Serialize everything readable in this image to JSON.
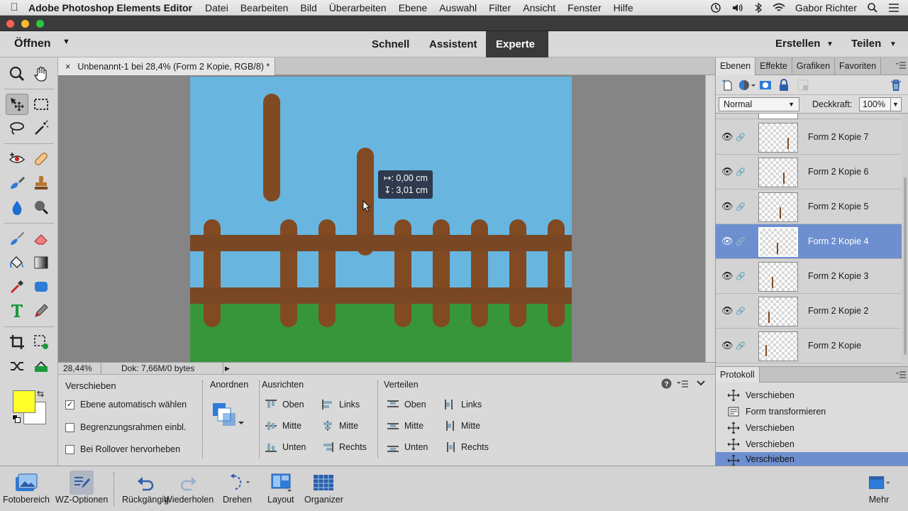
{
  "menubar": {
    "app_name": "Adobe Photoshop Elements Editor",
    "items": [
      "Datei",
      "Bearbeiten",
      "Bild",
      "Überarbeiten",
      "Ebene",
      "Auswahl",
      "Filter",
      "Ansicht",
      "Fenster",
      "Hilfe"
    ],
    "user": "Gabor Richter"
  },
  "modebar": {
    "open_label": "Öffnen",
    "modes": [
      "Schnell",
      "Assistent",
      "Experte"
    ],
    "active_mode": "Experte",
    "create_label": "Erstellen",
    "share_label": "Teilen"
  },
  "document": {
    "tab_title": "Unbenannt-1 bei 28,4% (Form 2 Kopie, RGB/8) *",
    "close_glyph": "×",
    "zoom": "28,44%",
    "doc_info": "Dok: 7,66M/0 bytes",
    "tooltip_line1": "↦: 0,00 cm",
    "tooltip_line2": "↧: 3,01 cm"
  },
  "colors": {
    "sky": "#68b6e0",
    "grass": "#37963a",
    "wood": "#814a22",
    "rail": "#7a4724",
    "foreground": "#ffff2a",
    "background": "#ffffff",
    "selection": "#6d8fcf"
  },
  "options": {
    "tool_name": "Verschieben",
    "check1": "Ebene automatisch wählen",
    "check1_checked": true,
    "check2": "Begrenzungsrahmen einbl.",
    "check3": "Bei Rollover hervorheben",
    "arrange_label": "Anordnen",
    "align_label": "Ausrichten",
    "distribute_label": "Verteilen",
    "top": "Oben",
    "middle": "Mitte",
    "bottom": "Unten",
    "left": "Links",
    "center": "Mitte",
    "right": "Rechts"
  },
  "panels": {
    "tabs": [
      "Ebenen",
      "Effekte",
      "Grafiken",
      "Favoriten"
    ],
    "blend_mode": "Normal",
    "opacity_label": "Deckkraft:",
    "opacity_value": "100%",
    "layers": [
      "Form 2 Kopie 7",
      "Form 2 Kopie 6",
      "Form 2 Kopie 5",
      "Form 2 Kopie 4",
      "Form 2 Kopie 3",
      "Form 2 Kopie 2",
      "Form 2 Kopie"
    ],
    "selected_layer": "Form 2 Kopie 4",
    "history_tab": "Protokoll",
    "history": [
      "Verschieben",
      "Form transformieren",
      "Verschieben",
      "Verschieben",
      "Verschieben"
    ]
  },
  "bottombar": {
    "items": [
      "Fotobereich",
      "WZ-Optionen",
      "Rückgängig",
      "Wiederholen",
      "Drehen",
      "Layout",
      "Organizer"
    ],
    "more": "Mehr"
  }
}
